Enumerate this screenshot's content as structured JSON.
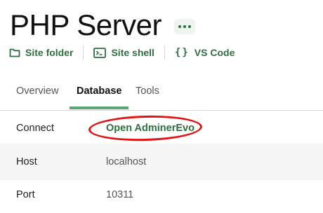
{
  "header": {
    "title": "PHP Server",
    "more_icon": "more-dots-icon"
  },
  "actions": [
    {
      "label": "Site folder",
      "icon": "folder-icon"
    },
    {
      "label": "Site shell",
      "icon": "terminal-icon"
    },
    {
      "label": "VS Code",
      "icon": "code-braces-icon"
    }
  ],
  "tabs": [
    {
      "label": "Overview",
      "active": false
    },
    {
      "label": "Database",
      "active": true
    },
    {
      "label": "Tools",
      "active": false
    }
  ],
  "database": {
    "rows": [
      {
        "key": "Connect",
        "value": "Open AdminerEvo"
      },
      {
        "key": "Host",
        "value": "localhost"
      },
      {
        "key": "Port",
        "value": "10311"
      }
    ]
  },
  "colors": {
    "accent": "#2e6f40",
    "tab_underline": "#5aa572",
    "annotation": "#e01515"
  }
}
